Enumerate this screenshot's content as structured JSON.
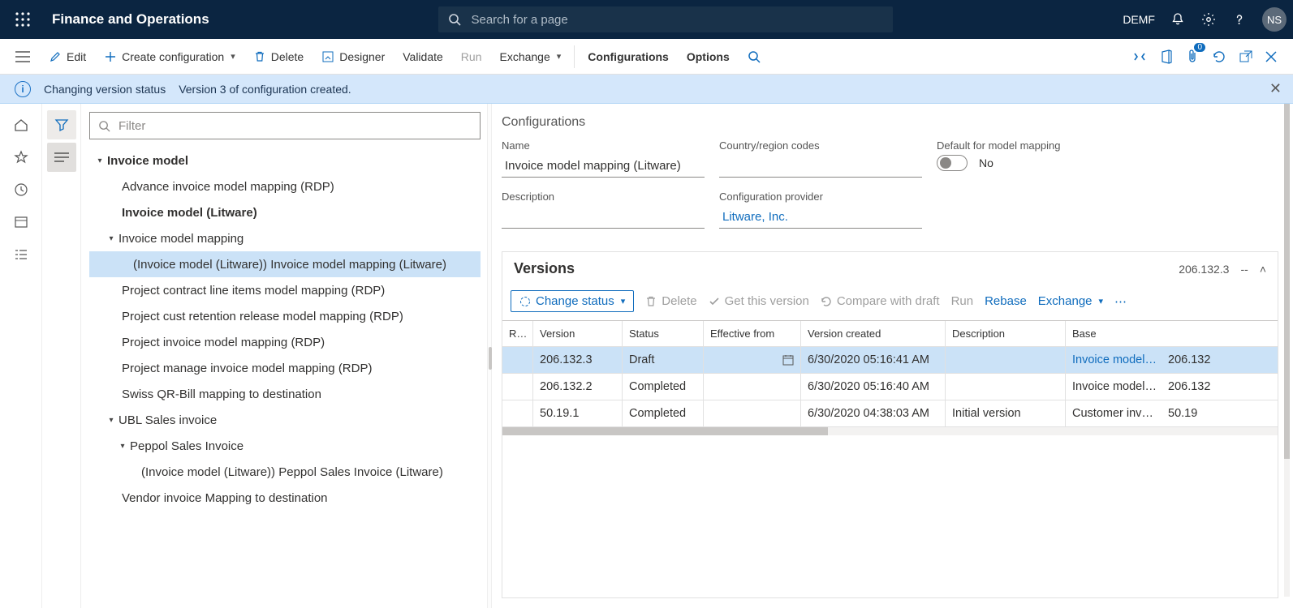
{
  "header": {
    "app_title": "Finance and Operations",
    "search_placeholder": "Search for a page",
    "company": "DEMF",
    "user_initials": "NS"
  },
  "commandbar": {
    "edit": "Edit",
    "create_config": "Create configuration",
    "delete": "Delete",
    "designer": "Designer",
    "validate": "Validate",
    "run": "Run",
    "exchange": "Exchange",
    "configurations": "Configurations",
    "options": "Options",
    "attach_badge": "0"
  },
  "banner": {
    "title": "Changing version status",
    "message": "Version 3 of configuration created."
  },
  "filter_placeholder": "Filter",
  "tree": {
    "n0": "Invoice model",
    "n1": "Advance invoice model mapping (RDP)",
    "n2": "Invoice model (Litware)",
    "n3": "Invoice model mapping",
    "n4": "(Invoice model (Litware)) Invoice model mapping (Litware)",
    "n5": "Project contract line items model mapping (RDP)",
    "n6": "Project cust retention release model mapping (RDP)",
    "n7": "Project invoice model mapping (RDP)",
    "n8": "Project manage invoice model mapping (RDP)",
    "n9": "Swiss QR-Bill mapping to destination",
    "n10": "UBL Sales invoice",
    "n11": "Peppol Sales Invoice",
    "n12": "(Invoice model (Litware)) Peppol Sales Invoice (Litware)",
    "n13": "Vendor invoice Mapping to destination"
  },
  "details": {
    "section_title": "Configurations",
    "name_label": "Name",
    "name_value": "Invoice model mapping (Litware)",
    "country_label": "Country/region codes",
    "country_value": "",
    "default_label": "Default for model mapping",
    "default_value": "No",
    "description_label": "Description",
    "description_value": "",
    "provider_label": "Configuration provider",
    "provider_value": "Litware, Inc."
  },
  "versions": {
    "title": "Versions",
    "summary_version": "206.132.3",
    "summary_revision": "--",
    "toolbar": {
      "change_status": "Change status",
      "delete": "Delete",
      "get_this_version": "Get this version",
      "compare": "Compare with draft",
      "run": "Run",
      "rebase": "Rebase",
      "exchange": "Exchange"
    },
    "columns": {
      "revision": "R…",
      "version": "Version",
      "status": "Status",
      "effective": "Effective from",
      "created": "Version created",
      "description": "Description",
      "base": "Base"
    },
    "rows": [
      {
        "revision": "",
        "version": "206.132.3",
        "status": "Draft",
        "effective": "",
        "created": "6/30/2020 05:16:41 AM",
        "description": "",
        "base_name": "Invoice model…",
        "base_ver": "206.132"
      },
      {
        "revision": "",
        "version": "206.132.2",
        "status": "Completed",
        "effective": "",
        "created": "6/30/2020 05:16:40 AM",
        "description": "",
        "base_name": "Invoice model…",
        "base_ver": "206.132"
      },
      {
        "revision": "",
        "version": "50.19.1",
        "status": "Completed",
        "effective": "",
        "created": "6/30/2020 04:38:03 AM",
        "description": "Initial version",
        "base_name": "Customer inv…",
        "base_ver": "50.19"
      }
    ]
  }
}
